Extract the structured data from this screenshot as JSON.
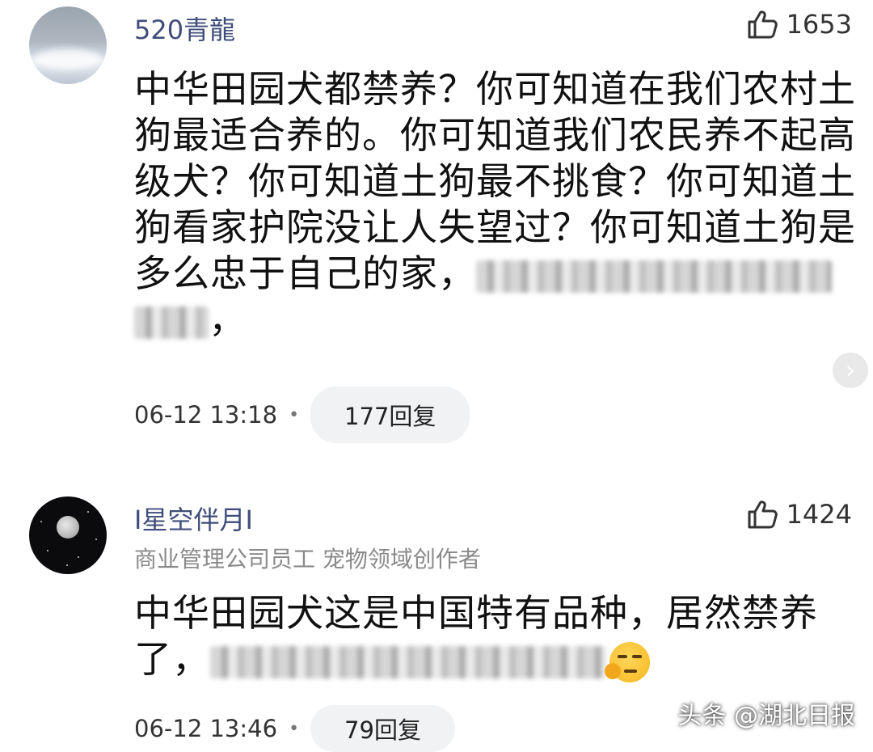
{
  "comments": [
    {
      "username": "520青龍",
      "avatar_icon": "sky-clouds-avatar",
      "likes": "1653",
      "lines": [
        "中华田园犬都禁养？你可知道在我们农村土",
        "狗最适合养的。你可知道我们农民养不起高",
        "级犬？你可知道土狗最不挑食？你可知道土",
        "狗看家护院没让人失望过？你可知道土狗是",
        "多么忠于自己的家，",
        "，"
      ],
      "time": "06-12 13:18",
      "replies": "177回复"
    },
    {
      "username": "I星空伴月I",
      "avatar_icon": "moon-night-avatar",
      "likes": "1424",
      "bio": "商业管理公司员工 宠物领域创作者",
      "lines": [
        "中华田园犬这是中国特有品种，居然禁养",
        "了，"
      ],
      "emoji_icon": "smirk-thinking-emoji-icon",
      "time": "06-12 13:46",
      "replies": "79回复"
    }
  ],
  "watermark": "头条 @湖北日报",
  "colors": {
    "username": "#3f4d7a",
    "reply_pill_bg": "#f1f2f4",
    "meta_text": "#333333",
    "bio_text": "#8a8a8a"
  }
}
